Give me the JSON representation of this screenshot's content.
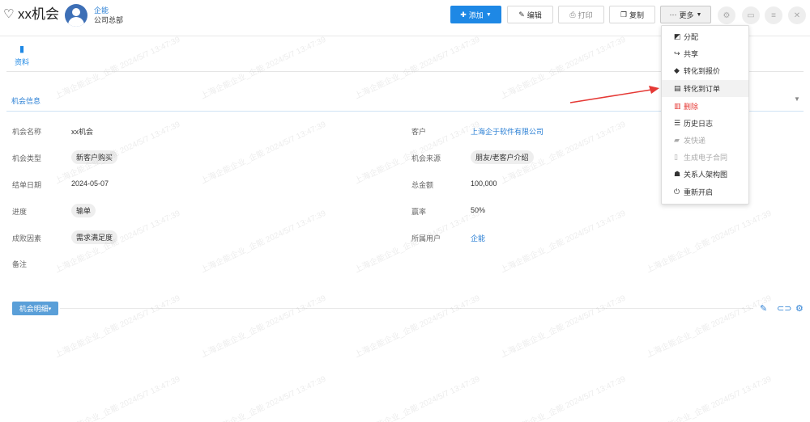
{
  "header": {
    "title": "xx机会",
    "owner_name": "企能",
    "owner_dept": "公司总部",
    "buttons": {
      "add": "添加",
      "edit": "编辑",
      "print": "打印",
      "copy": "复制",
      "more": "更多"
    }
  },
  "tab": {
    "label": "资料"
  },
  "section": {
    "title": "机会信息"
  },
  "fields": {
    "name_label": "机会名称",
    "name_value": "xx机会",
    "type_label": "机会类型",
    "type_value": "新客户购买",
    "close_date_label": "结单日期",
    "close_date_value": "2024-05-07",
    "progress_label": "进度",
    "progress_value": "输单",
    "factor_label": "成败因素",
    "factor_value": "需求满足度",
    "remark_label": "备注",
    "customer_label": "客户",
    "customer_value": "上海企于软件有限公司",
    "source_label": "机会来源",
    "source_value": "朋友/老客户介绍",
    "amount_label": "总金额",
    "amount_value": "100,000",
    "win_rate_label": "赢率",
    "win_rate_value": "50%",
    "owner_label": "所属用户",
    "owner_value": "企能"
  },
  "detail": {
    "button_label": "机会明细"
  },
  "more_menu": {
    "items": [
      {
        "label": "分配",
        "icon": "assign-icon"
      },
      {
        "label": "共享",
        "icon": "share-icon"
      },
      {
        "label": "转化到报价",
        "icon": "cube-icon"
      },
      {
        "label": "转化到订单",
        "icon": "document-icon",
        "highlighted": true
      },
      {
        "label": "删除",
        "icon": "trash-icon",
        "danger": true
      },
      {
        "label": "历史日志",
        "icon": "list-icon"
      },
      {
        "label": "发快递",
        "icon": "truck-icon",
        "disabled": true
      },
      {
        "label": "生成电子合同",
        "icon": "file-icon",
        "disabled": true
      },
      {
        "label": "关系人架构图",
        "icon": "org-chart-icon"
      },
      {
        "label": "重新开启",
        "icon": "power-icon"
      }
    ]
  },
  "watermark": {
    "text": "上海企能企业_企能  2024/5/7 13:47:39"
  },
  "colors": {
    "accent": "#1e88e5",
    "link": "#2a7fd4",
    "danger": "#e53935",
    "arrow": "#e53935"
  }
}
